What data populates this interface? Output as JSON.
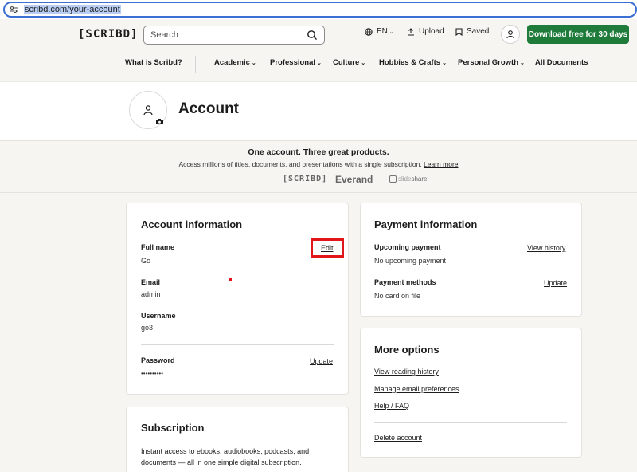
{
  "browser": {
    "url": "scribd.com/your-account"
  },
  "header": {
    "logo": "[SCRIBD]",
    "search_placeholder": "Search",
    "language": "EN",
    "upload": "Upload",
    "saved": "Saved",
    "cta": "Download free for 30 days"
  },
  "categories": [
    {
      "label": "What is Scribd?",
      "has_chevron": false
    },
    {
      "label": "Academic",
      "has_chevron": true
    },
    {
      "label": "Professional",
      "has_chevron": true
    },
    {
      "label": "Culture",
      "has_chevron": true
    },
    {
      "label": "Hobbies & Crafts",
      "has_chevron": true
    },
    {
      "label": "Personal Growth",
      "has_chevron": true
    },
    {
      "label": "All Documents",
      "has_chevron": false
    }
  ],
  "page": {
    "title": "Account"
  },
  "promo": {
    "title": "One account. Three great products.",
    "subtitle": "Access millions of titles, documents, and presentations with a single subscription.",
    "learn_more": "Learn more",
    "brand_scribd": "[SCRIBD]",
    "brand_everand": "Everand",
    "brand_slideshare_a": "slide",
    "brand_slideshare_b": "share"
  },
  "account_info": {
    "heading": "Account information",
    "full_name_label": "Full name",
    "full_name_value": "Go",
    "edit": "Edit",
    "email_label": "Email",
    "email_value": "admin",
    "username_label": "Username",
    "username_value": "go3",
    "password_label": "Password",
    "password_value": "••••••••••",
    "update": "Update"
  },
  "payment_info": {
    "heading": "Payment information",
    "upcoming_label": "Upcoming payment",
    "upcoming_value": "No upcoming payment",
    "view_history": "View history",
    "methods_label": "Payment methods",
    "methods_value": "No card on file",
    "update": "Update"
  },
  "more_options": {
    "heading": "More options",
    "links": [
      "View reading history",
      "Manage email preferences",
      "Help / FAQ"
    ],
    "delete": "Delete account"
  },
  "subscription": {
    "heading": "Subscription",
    "description_line1": "Instant access to ebooks, audiobooks, podcasts, and",
    "description_line2": "documents — all in one simple digital subscription."
  },
  "colors": {
    "cta_green": "#1e7b3a",
    "highlight_red": "#e0161a",
    "url_border": "#3b6fd4"
  }
}
